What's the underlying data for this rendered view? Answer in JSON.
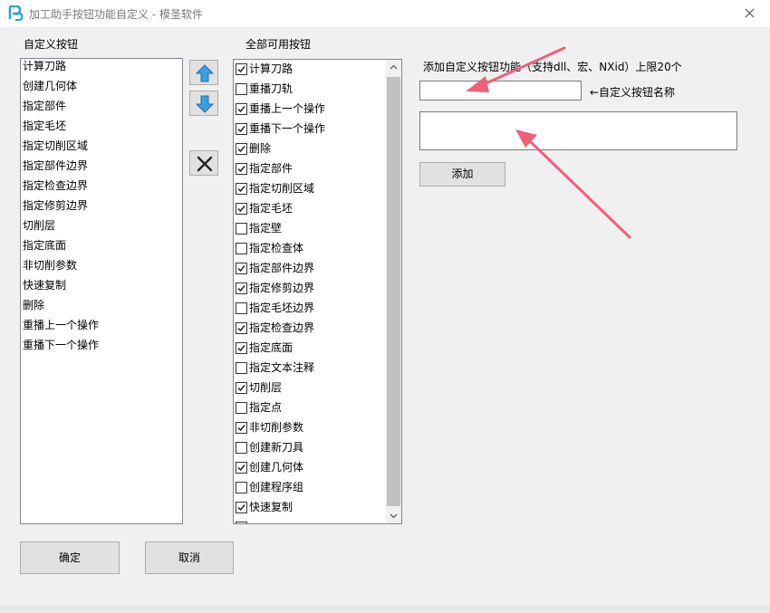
{
  "window": {
    "title": "加工助手按钮功能自定义 - 模圣软件"
  },
  "left_panel": {
    "label": "自定义按钮",
    "items": [
      "计算刀路",
      "创建几何体",
      "指定部件",
      "指定毛坯",
      "指定切削区域",
      "指定部件边界",
      "指定检查边界",
      "指定修剪边界",
      "切削层",
      "指定底面",
      "非切削参数",
      "快速复制",
      "删除",
      "重播上一个操作",
      "重播下一个操作"
    ]
  },
  "middle_panel": {
    "label": "全部可用按钮",
    "items": [
      {
        "label": "计算刀路",
        "checked": true
      },
      {
        "label": "重播刀轨",
        "checked": false
      },
      {
        "label": "重播上一个操作",
        "checked": true
      },
      {
        "label": "重播下一个操作",
        "checked": true
      },
      {
        "label": "删除",
        "checked": true
      },
      {
        "label": "指定部件",
        "checked": true
      },
      {
        "label": "指定切削区域",
        "checked": true
      },
      {
        "label": "指定毛坯",
        "checked": true
      },
      {
        "label": "指定壁",
        "checked": false
      },
      {
        "label": "指定检查体",
        "checked": false
      },
      {
        "label": "指定部件边界",
        "checked": true
      },
      {
        "label": "指定修剪边界",
        "checked": true
      },
      {
        "label": "指定毛坯边界",
        "checked": false
      },
      {
        "label": "指定检查边界",
        "checked": true
      },
      {
        "label": "指定底面",
        "checked": true
      },
      {
        "label": "指定文本注释",
        "checked": false
      },
      {
        "label": "切削层",
        "checked": true
      },
      {
        "label": "指定点",
        "checked": false
      },
      {
        "label": "非切削参数",
        "checked": true
      },
      {
        "label": "创建新刀具",
        "checked": false
      },
      {
        "label": "创建几何体",
        "checked": true
      },
      {
        "label": "创建程序组",
        "checked": false
      },
      {
        "label": "快速复制",
        "checked": true
      },
      {
        "label": "",
        "checked": true
      }
    ]
  },
  "right_panel": {
    "instruction": "添加自定义按钮功能（支持dll、宏、NXid）上限20个",
    "name_hint": "←自定义按钮名称",
    "name_value": "",
    "function_value": "",
    "add_button": "添加"
  },
  "footer": {
    "ok_button": "确定",
    "cancel_button": "取消"
  },
  "colors": {
    "accent": "#0078d7",
    "annotation_arrow": "#f0607a"
  }
}
